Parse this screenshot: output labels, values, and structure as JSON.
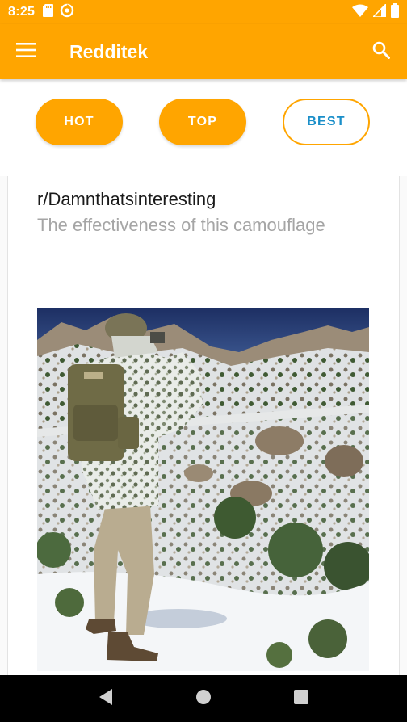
{
  "status_bar": {
    "time": "8:25",
    "icons_left": [
      "sd-card-icon",
      "data-saver-icon"
    ],
    "icons_right": [
      "wifi-icon",
      "signal-icon",
      "battery-icon"
    ]
  },
  "app_bar": {
    "title": "Redditek",
    "menu_icon": "menu-icon",
    "search_icon": "search-icon",
    "background": "#ffa500"
  },
  "filters": {
    "items": [
      {
        "label": "HOT",
        "selected": false
      },
      {
        "label": "TOP",
        "selected": false
      },
      {
        "label": "BEST",
        "selected": true
      }
    ],
    "accent": "#ffa500",
    "selected_text_color": "#1b8fc9"
  },
  "post": {
    "subreddit": "r/Damnthatsinteresting",
    "title": "The effectiveness of this camouflage",
    "image_subject": "soldier in snow camouflage on a rocky snowy hillside"
  },
  "nav_bar": {
    "buttons": [
      "back-icon",
      "home-icon",
      "recents-icon"
    ]
  }
}
